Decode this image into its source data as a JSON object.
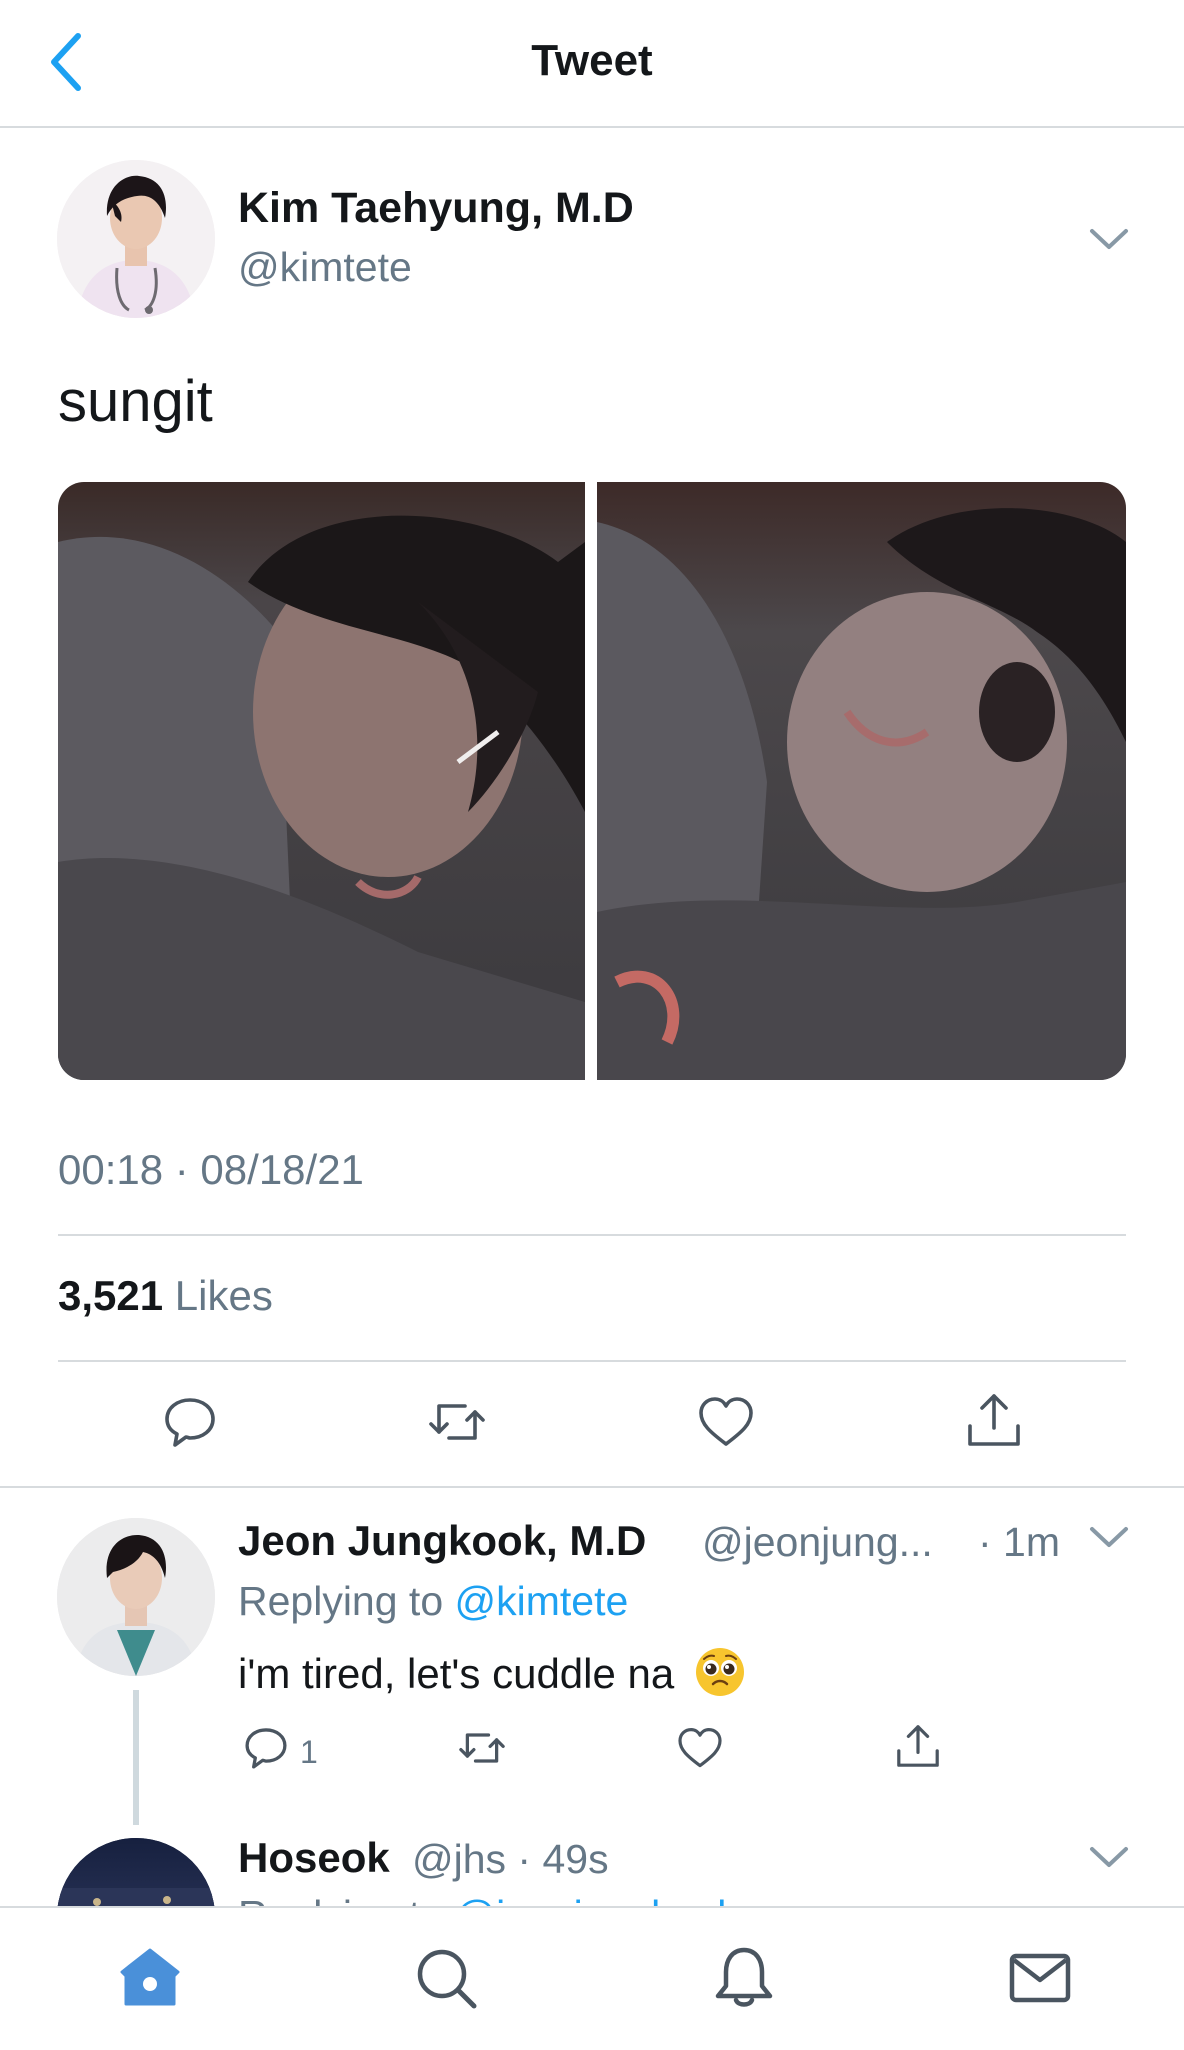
{
  "header": {
    "title": "Tweet",
    "back_icon": "chevron-left-icon"
  },
  "tweet": {
    "author": {
      "name": "Kim Taehyung, M.D",
      "handle": "@kimtete"
    },
    "text": "sungit",
    "timestamp": "00:18 · 08/18/21",
    "likes": {
      "count": "3,521",
      "label": "Likes"
    },
    "actions": [
      "reply-icon",
      "retweet-icon",
      "like-icon",
      "share-icon"
    ]
  },
  "replies": [
    {
      "name": "Jeon Jungkook, M.D",
      "handle": "@jeonjung...",
      "time": "· 1m",
      "replying_prefix": "Replying to ",
      "replying_to": "@kimtete",
      "text": "i'm tired, let's cuddle na",
      "emoji": "pleading-face",
      "reply_count": "1"
    },
    {
      "name": "Hoseok",
      "meta": "@jhs · 49s",
      "replying_prefix": "Replying to ",
      "replying_to": "@jeonjungkook"
    }
  ],
  "tabs": [
    "home-icon",
    "search-icon",
    "notifications-icon",
    "messages-icon"
  ],
  "colors": {
    "accent": "#1da1f2",
    "secondary_text": "#657786",
    "divider": "#d7dbde",
    "tab_active": "#4a90d9"
  }
}
